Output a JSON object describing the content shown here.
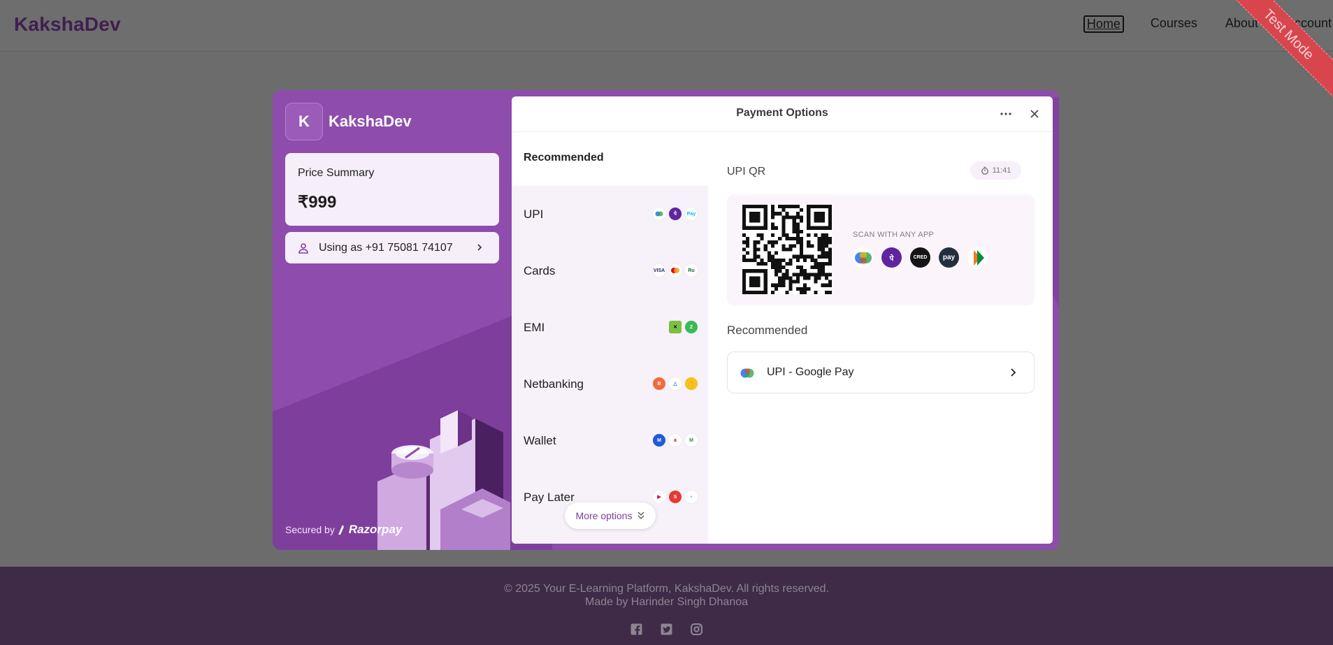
{
  "site": {
    "brand": "KakshaDev",
    "nav": [
      "Home",
      "Courses",
      "About",
      "Account"
    ],
    "ribbon": "Test Mode",
    "footer_line1": "© 2025 Your E-Learning Platform, KakshaDev. All rights reserved.",
    "footer_line2": "Made by Harinder Singh Dhanoa",
    "social_icons": [
      "facebook-icon",
      "twitter-icon",
      "instagram-icon"
    ]
  },
  "checkout": {
    "merchant_initial": "K",
    "merchant_name": "KakshaDev",
    "price_label": "Price Summary",
    "price_value": "₹999",
    "user_label": "Using as +91 75081 74107",
    "secured_by": "Secured by",
    "provider": "Razorpay",
    "panel_title": "Payment Options",
    "methods_heading": "Recommended",
    "methods": [
      {
        "label": "UPI",
        "icons": [
          "gpay",
          "phonepe",
          "paytm"
        ]
      },
      {
        "label": "Cards",
        "icons": [
          "visa",
          "mastercard",
          "rupay"
        ]
      },
      {
        "label": "EMI",
        "icons": [
          "emi-x",
          "zest"
        ]
      },
      {
        "label": "Netbanking",
        "icons": [
          "bank-1",
          "bank-2",
          "bank-3"
        ]
      },
      {
        "label": "Wallet",
        "icons": [
          "mobikwik",
          "airtel",
          "amazon"
        ]
      },
      {
        "label": "Pay Later",
        "icons": [
          "lazypay",
          "simpl",
          "icici"
        ]
      }
    ],
    "more_options": "More options",
    "upi_qr_title": "UPI QR",
    "timer": "11:41",
    "scan_text": "SCAN WITH ANY APP",
    "upi_apps": [
      "gpay",
      "phonepe",
      "cred",
      "amazon-pay",
      "bhim"
    ],
    "recommended_title": "Recommended",
    "recommended_option": "UPI - Google Pay",
    "colors": {
      "accent": "#8e4cad",
      "panel": "#ffffff",
      "ribbon": "#d8454d",
      "footer": "#3f2a48"
    }
  }
}
